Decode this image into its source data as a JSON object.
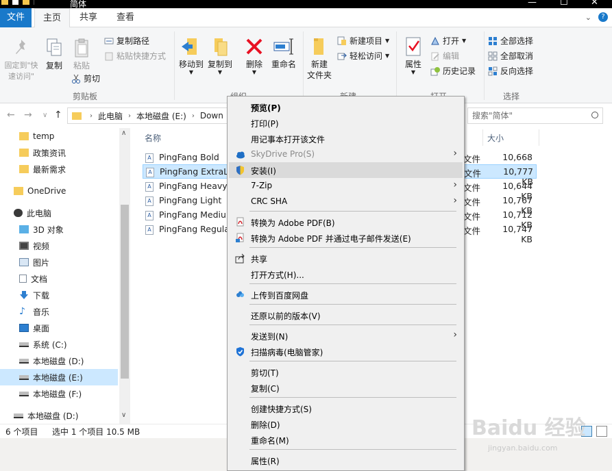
{
  "window": {
    "title": "简体",
    "controls": [
      "—",
      "☐",
      "✕"
    ]
  },
  "ribbon_tabs": [
    {
      "label": "文件"
    },
    {
      "label": "主页"
    },
    {
      "label": "共享"
    },
    {
      "label": "查看"
    }
  ],
  "ribbon": {
    "clipboard": {
      "pin_label": "固定到\"快速访问\"",
      "copy_label": "复制",
      "paste_label": "粘贴",
      "copy_path_label": "复制路径",
      "paste_shortcut_label": "粘贴快捷方式",
      "cut_label": "剪切",
      "group_label": "剪贴板"
    },
    "organize": {
      "move_to_label": "移动到",
      "copy_to_label": "复制到",
      "delete_label": "删除",
      "rename_label": "重命名",
      "group_label": "组织"
    },
    "new": {
      "new_folder_label": "新建\n文件夹",
      "new_item_label": "新建项目",
      "easy_access_label": "轻松访问",
      "group_label": "新建"
    },
    "open": {
      "properties_label": "属性",
      "open_label": "打开",
      "edit_label": "编辑",
      "history_label": "历史记录",
      "group_label": "打开"
    },
    "select": {
      "select_all_label": "全部选择",
      "select_none_label": "全部取消",
      "invert_label": "反向选择",
      "group_label": "选择"
    }
  },
  "address": {
    "crumbs": [
      "此电脑",
      "本地磁盘 (E:)",
      "Down"
    ],
    "search_placeholder": "搜索\"简体\""
  },
  "nav_pane": {
    "items": [
      {
        "label": "temp",
        "icon": "folder-icon"
      },
      {
        "label": "政策资讯",
        "icon": "folder-icon"
      },
      {
        "label": "最新需求",
        "icon": "folder-icon"
      },
      {
        "label": "OneDrive",
        "icon": "folder-icon"
      },
      {
        "label": "此电脑",
        "icon": "pc-icon"
      },
      {
        "label": "3D 对象",
        "icon": "cube-icon"
      },
      {
        "label": "视频",
        "icon": "video-icon"
      },
      {
        "label": "图片",
        "icon": "picture-icon"
      },
      {
        "label": "文档",
        "icon": "document-icon"
      },
      {
        "label": "下载",
        "icon": "download-icon"
      },
      {
        "label": "音乐",
        "icon": "music-icon"
      },
      {
        "label": "桌面",
        "icon": "desktop-icon"
      },
      {
        "label": "系统 (C:)",
        "icon": "drive-icon"
      },
      {
        "label": "本地磁盘 (D:)",
        "icon": "drive-icon"
      },
      {
        "label": "本地磁盘 (E:)",
        "icon": "drive-icon"
      },
      {
        "label": "本地磁盘 (F:)",
        "icon": "drive-icon"
      },
      {
        "label": "本地磁盘 (D:)",
        "icon": "drive-icon"
      }
    ]
  },
  "file_list": {
    "columns": [
      "名称",
      "大小"
    ],
    "rows": [
      {
        "name": "PingFang Bold",
        "type": "文件",
        "size": "10,668 KB"
      },
      {
        "name": "PingFang ExtraLig",
        "type": "文件",
        "size": "10,777 KB"
      },
      {
        "name": "PingFang Heavy",
        "type": "文件",
        "size": "10,644 KB"
      },
      {
        "name": "PingFang Light",
        "type": "文件",
        "size": "10,767 KB"
      },
      {
        "name": "PingFang Mediur",
        "type": "文件",
        "size": "10,712 KB"
      },
      {
        "name": "PingFang Regular",
        "type": "文件",
        "size": "10,747 KB"
      }
    ]
  },
  "status_bar": {
    "count": "6 个项目",
    "selection": "选中 1 个项目  10.5 MB"
  },
  "context_menu": {
    "items": [
      {
        "label": "预览(P)"
      },
      {
        "label": "打印(P)"
      },
      {
        "label": "用记事本打开该文件"
      },
      {
        "label": "SkyDrive Pro(S)"
      },
      {
        "label": "安装(I)"
      },
      {
        "label": "7-Zip"
      },
      {
        "label": "CRC SHA"
      },
      {
        "label": "转换为 Adobe PDF(B)"
      },
      {
        "label": "转换为 Adobe PDF 并通过电子邮件发送(E)"
      },
      {
        "label": "共享"
      },
      {
        "label": "打开方式(H)..."
      },
      {
        "label": "上传到百度网盘"
      },
      {
        "label": "还原以前的版本(V)"
      },
      {
        "label": "发送到(N)"
      },
      {
        "label": "扫描病毒(电脑管家)"
      },
      {
        "label": "剪切(T)"
      },
      {
        "label": "复制(C)"
      },
      {
        "label": "创建快捷方式(S)"
      },
      {
        "label": "删除(D)"
      },
      {
        "label": "重命名(M)"
      },
      {
        "label": "属性(R)"
      }
    ]
  },
  "watermark": {
    "logo": "Baidu 经验",
    "url": "jingyan.baidu.com"
  },
  "colors": {
    "file_tab": "#1979ca",
    "selection": "#cce8ff",
    "menu_bg": "#f0f0f0",
    "menu_highlight": "#dadada",
    "folder": "#f6cc5b",
    "delete_red": "#e81123"
  }
}
